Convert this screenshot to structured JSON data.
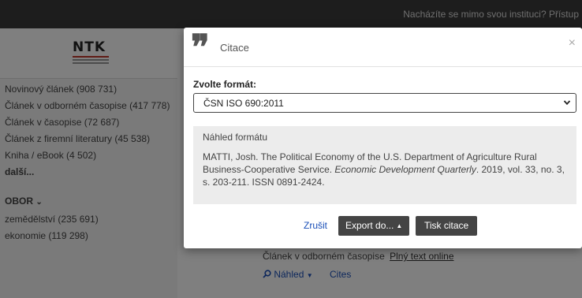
{
  "topbar": {
    "notice": "Nacházíte se mimo svou instituci? Přístup"
  },
  "logo": {
    "text": "NTK"
  },
  "sidebar": {
    "facets": [
      {
        "label": "Novinový článek (908 731)"
      },
      {
        "label": "Článek v odborném časopise (417 778)"
      },
      {
        "label": "Článek v časopise (72 687)"
      },
      {
        "label": "Článek z firemní literatury (45 538)"
      },
      {
        "label": "Kniha / eBook (4 502)"
      }
    ],
    "more_label": "další...",
    "section_heading": "OBOR",
    "section_chevron": "⌄",
    "section_items": [
      {
        "label": "zemědělství (235 691)"
      },
      {
        "label": "ekonomie (119 298)"
      }
    ]
  },
  "result": {
    "type_label": "Článek v odborném časopise",
    "fulltext_label": "Plný text online",
    "preview_label": "Náhled",
    "cites_label": "Cites"
  },
  "modal": {
    "title": "Citace",
    "close_label": "×",
    "format_label": "Zvolte formát:",
    "format_selected": "ČSN ISO 690:2011",
    "preview_heading": "Náhled formátu",
    "citation_part1": "MATTI, Josh. The Political Economy of the U.S. Department of Agriculture Rural Business-Cooperative Service. ",
    "citation_journal": "Economic Development Quarterly",
    "citation_part2": ". 2019, vol. 33, no. 3, s. 203-211. ISSN 0891-2424.",
    "cancel_label": "Zrušit",
    "export_label": "Export do...",
    "export_caret": "▲",
    "print_label": "Tisk citace"
  }
}
